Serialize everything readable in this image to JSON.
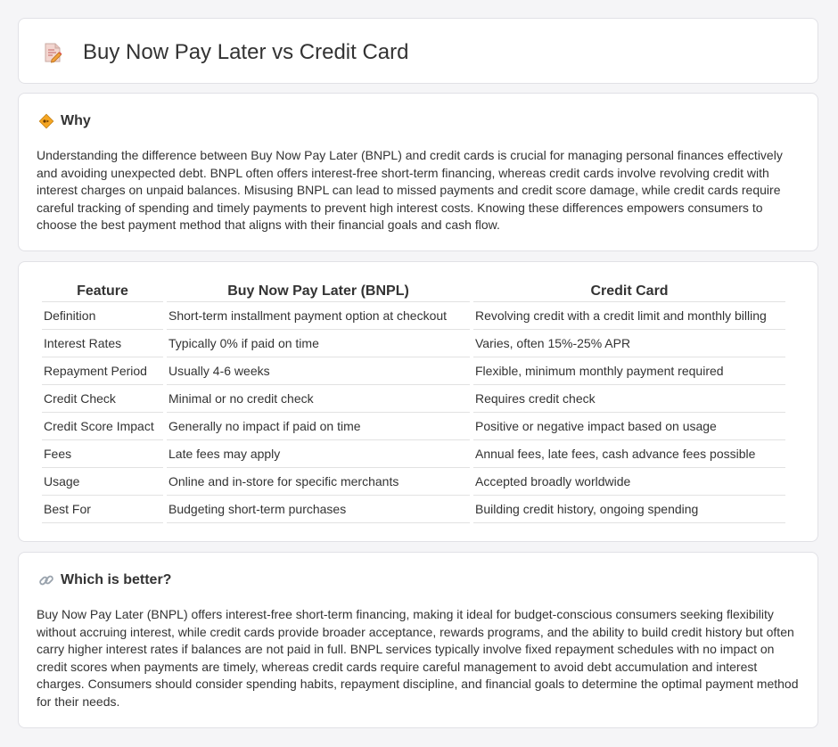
{
  "header": {
    "title": "Buy Now Pay Later vs Credit Card",
    "icon": "document-pencil-icon"
  },
  "why": {
    "title": "Why",
    "icon": "diamond-sign-icon",
    "text": "Understanding the difference between Buy Now Pay Later (BNPL) and credit cards is crucial for managing personal finances effectively and avoiding unexpected debt. BNPL often offers interest-free short-term financing, whereas credit cards involve revolving credit with interest charges on unpaid balances. Misusing BNPL can lead to missed payments and credit score damage, while credit cards require careful tracking of spending and timely payments to prevent high interest costs. Knowing these differences empowers consumers to choose the best payment method that aligns with their financial goals and cash flow."
  },
  "table": {
    "headers": [
      "Feature",
      "Buy Now Pay Later (BNPL)",
      "Credit Card"
    ],
    "rows": [
      [
        "Definition",
        "Short-term installment payment option at checkout",
        "Revolving credit with a credit limit and monthly billing"
      ],
      [
        "Interest Rates",
        "Typically 0% if paid on time",
        "Varies, often 15%-25% APR"
      ],
      [
        "Repayment Period",
        "Usually 4-6 weeks",
        "Flexible, minimum monthly payment required"
      ],
      [
        "Credit Check",
        "Minimal or no credit check",
        "Requires credit check"
      ],
      [
        "Credit Score Impact",
        "Generally no impact if paid on time",
        "Positive or negative impact based on usage"
      ],
      [
        "Fees",
        "Late fees may apply",
        "Annual fees, late fees, cash advance fees possible"
      ],
      [
        "Usage",
        "Online and in-store for specific merchants",
        "Accepted broadly worldwide"
      ],
      [
        "Best For",
        "Budgeting short-term purchases",
        "Building credit history, ongoing spending"
      ]
    ]
  },
  "better": {
    "title": "Which is better?",
    "icon": "link-icon",
    "text": "Buy Now Pay Later (BNPL) offers interest-free short-term financing, making it ideal for budget-conscious consumers seeking flexibility without accruing interest, while credit cards provide broader acceptance, rewards programs, and the ability to build credit history but often carry higher interest rates if balances are not paid in full. BNPL services typically involve fixed repayment schedules with no impact on credit scores when payments are timely, whereas credit cards require careful management to avoid debt accumulation and interest charges. Consumers should consider spending habits, repayment discipline, and financial goals to determine the optimal payment method for their needs."
  }
}
